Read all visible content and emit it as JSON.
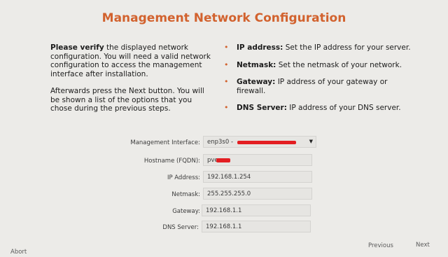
{
  "title": "Management Network Configuration",
  "intro": {
    "p1_bold": "Please verify",
    "p1_rest": " the displayed network configuration. You will need a valid network configuration to access the management interface after installation.",
    "p2": "Afterwards press the Next button. You will be shown a list of the options that you chose during the previous steps."
  },
  "bullets": [
    {
      "bold": "IP address:",
      "text": " Set the IP address for your server."
    },
    {
      "bold": "Netmask:",
      "text": " Set the netmask of your network."
    },
    {
      "bold": "Gateway:",
      "text": " IP address of your gateway or firewall."
    },
    {
      "bold": "DNS Server:",
      "text": " IP address of your DNS server."
    }
  ],
  "form": {
    "interface": {
      "label": "Management Interface:",
      "value": "enp3s0 -"
    },
    "hostname": {
      "label": "Hostname (FQDN):",
      "value": "pve"
    },
    "ip": {
      "label": "IP Address:",
      "value": "192.168.1.254"
    },
    "netmask": {
      "label": "Netmask:",
      "value": "255.255.255.0"
    },
    "gateway": {
      "label": "Gateway:",
      "value": "192.168.1.1"
    },
    "dns": {
      "label": "DNS Server:",
      "value": "192.168.1.1"
    }
  },
  "buttons": {
    "abort": "Abort",
    "previous": "Previous",
    "next": "Next"
  },
  "colors": {
    "accent": "#d2622e",
    "redaction": "#e31e22"
  }
}
